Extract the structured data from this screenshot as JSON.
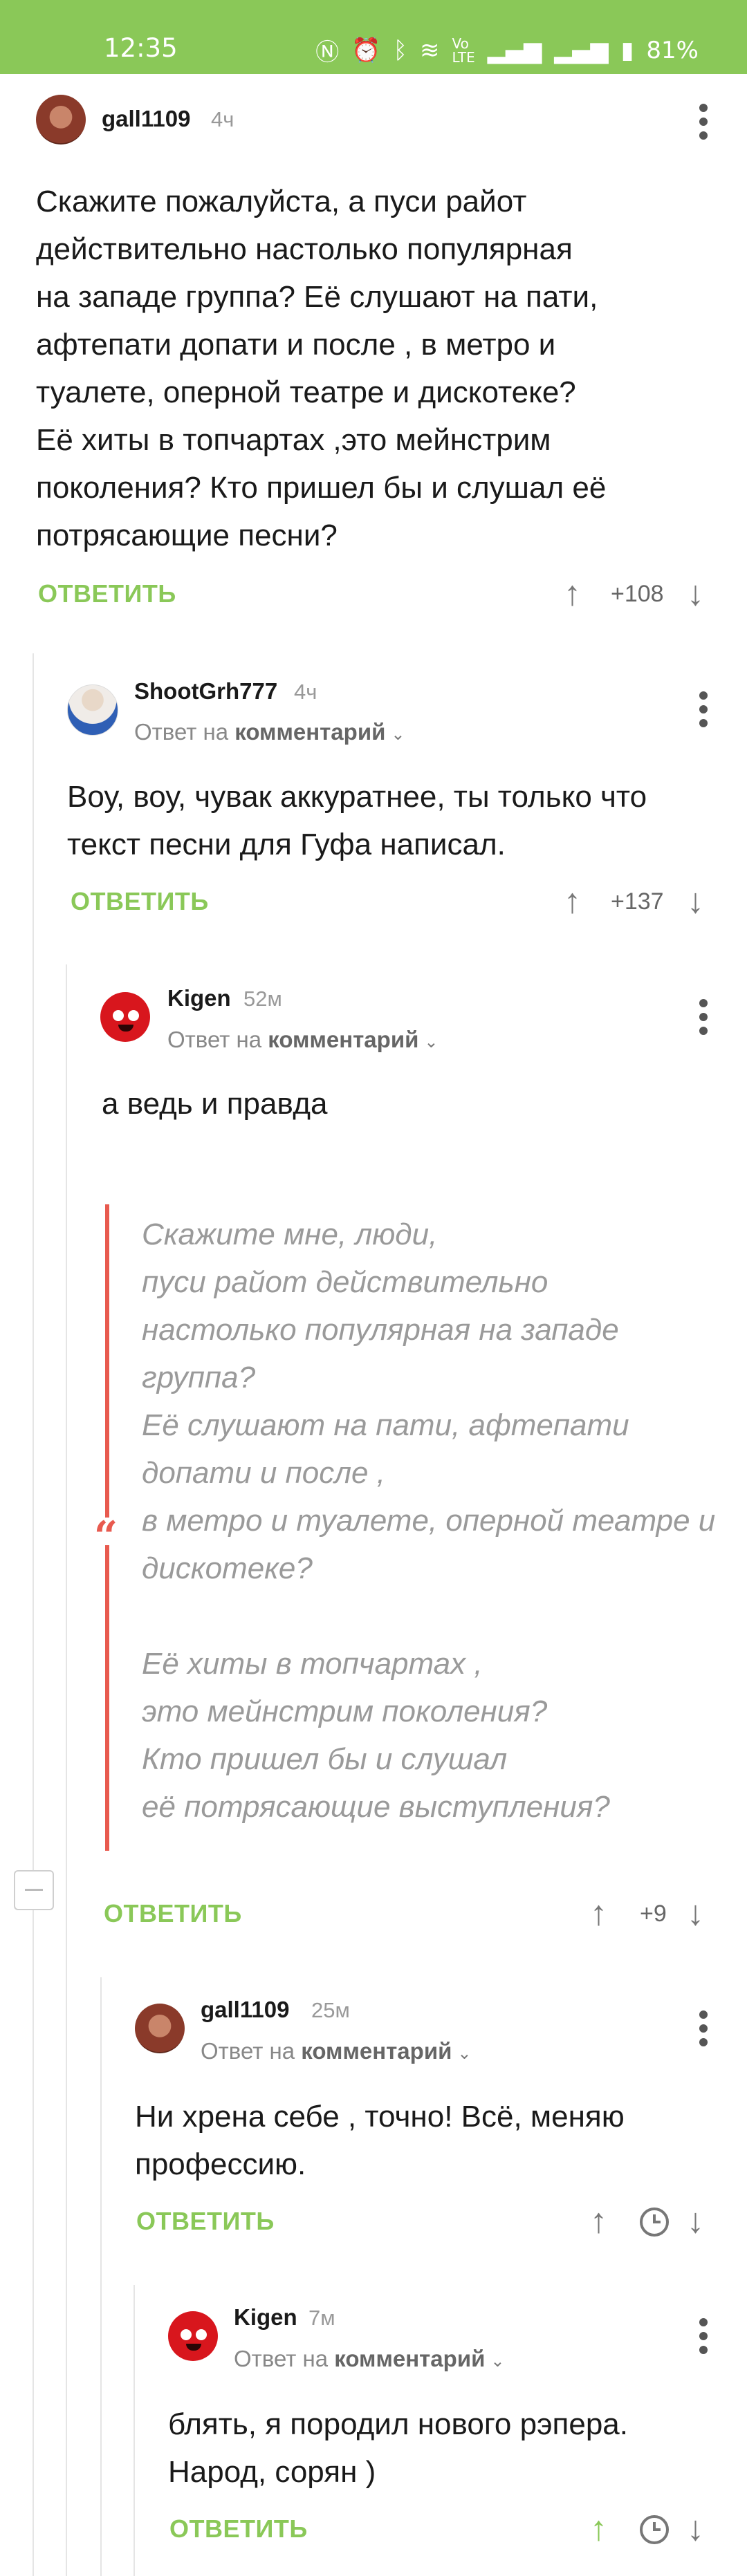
{
  "status_bar": {
    "time": "12:35",
    "battery": "81%",
    "icons": [
      "nfc-icon",
      "alarm-icon",
      "bluetooth-icon",
      "wifi-icon",
      "volte-icon",
      "signal-icon",
      "signal-icon",
      "battery-icon"
    ]
  },
  "ui": {
    "reply_label": "ОТВЕТИТЬ",
    "reply_to_prefix": "Ответ на",
    "reply_to_target": "комментарий"
  },
  "comments": [
    {
      "author": "gall1109",
      "time": "4ч",
      "lines": [
        "Скажите пожалуйста, а пуси райот",
        "действительно настолько популярная",
        "на западе группа? Её слушают на пати,",
        "афтепати допати и после , в метро и",
        "туалете, оперной театре и дискотеке?",
        "Её хиты в топчартах ,это мейнстрим",
        "поколения? Кто пришел бы и слушал её",
        "потрясающие песни?"
      ],
      "score": "+108"
    },
    {
      "author": "ShootGrh777",
      "time": "4ч",
      "lines": [
        "Воу, воу, чувак аккуратнее, ты только что",
        "текст песни для Гуфа написал."
      ],
      "score": "+137"
    },
    {
      "author": "Kigen",
      "time": "52м",
      "lines": [
        "а ведь и правда"
      ],
      "quote": "Скажите мне, люди,\nпуси райот действительно\nнастолько популярная на западе\nгруппа?\nЕё слушают на пати, афтепати\nдопати и после ,\nв метро и туалете, оперной театре и\nдискотеке?\n\nЕё хиты в топчартах ,\nэто мейнстрим поколения?\nКто пришел бы и слушал\nеё потрясающие выступления?",
      "score": "+9"
    },
    {
      "author": "gall1109",
      "time": "25м",
      "lines": [
        "Ни хрена себе , точно! Всё, меняю",
        "профессию."
      ],
      "score": ""
    },
    {
      "author": "Kigen",
      "time": "7м",
      "lines": [
        "блять, я породил нового рэпера.",
        "Народ, сорян )"
      ],
      "score": ""
    }
  ]
}
